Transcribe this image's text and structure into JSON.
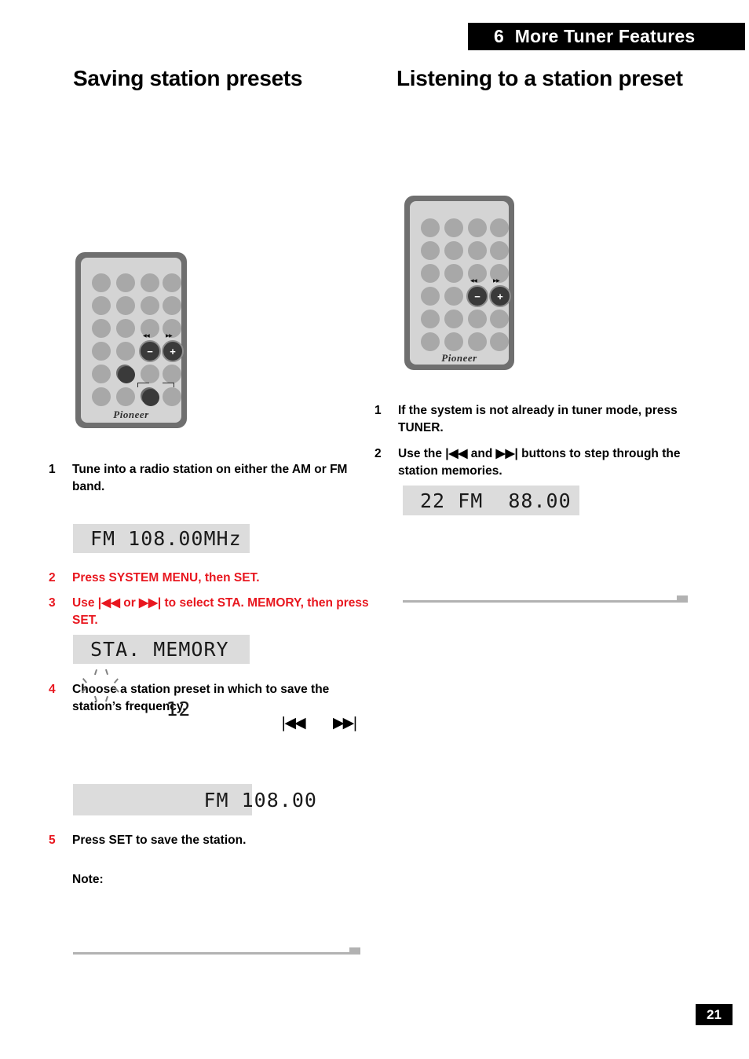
{
  "chapter": {
    "number": "6",
    "title": "More Tuner Features"
  },
  "sections": {
    "left_heading": "Saving station presets",
    "right_heading": "Listening to a station preset"
  },
  "left_column": {
    "steps": [
      {
        "num": "1",
        "text": "Tune into a radio station on either the AM or FM band.",
        "style": "black"
      },
      {
        "num": "2",
        "text": "Press SYSTEM MENU, then SET.",
        "style": "red"
      },
      {
        "num": "3",
        "text": "Use |◀◀ or ▶▶| to select STA. MEMORY, then press SET.",
        "style": "red"
      },
      {
        "num": "4",
        "text": "Choose a station preset in which to save the station’s frequency.",
        "style": "rednum"
      },
      {
        "num": "5",
        "text": "Press SET to save the station.",
        "style": "rednum"
      }
    ],
    "note_label": "Note:",
    "displays": [
      {
        "text": "FM 108.00MHz"
      },
      {
        "text": "STA. MEMORY"
      },
      {
        "blink_text": "12",
        "text": " FM 108.00"
      }
    ],
    "transport_glyphs": {
      "prev": "|◀◀",
      "next": "▶▶|"
    }
  },
  "right_column": {
    "steps": [
      {
        "num": "1",
        "text": "If the system is not already in tuner mode, press TUNER.",
        "style": "black"
      },
      {
        "num": "2",
        "text": "Use the |◀◀ and ▶▶| buttons to step through the station memories.",
        "style": "black"
      }
    ],
    "displays": [
      {
        "text": "22 FM  88.00"
      }
    ]
  },
  "remote_left": {
    "brand": "Pioneer",
    "skip_prev_label": "◀◀",
    "skip_next_label": "▶▶",
    "minus_label": "−",
    "plus_label": "+"
  },
  "remote_right": {
    "brand": "Pioneer",
    "skip_prev_label": "◀◀",
    "skip_next_label": "▶▶",
    "minus_label": "−",
    "plus_label": "+"
  },
  "footer": {
    "page_number": "21"
  },
  "colors": {
    "accent_red": "#e8171f",
    "header_bg": "#000000",
    "lcd_bg": "#dcdcdc",
    "rule": "#b2b2b2"
  }
}
